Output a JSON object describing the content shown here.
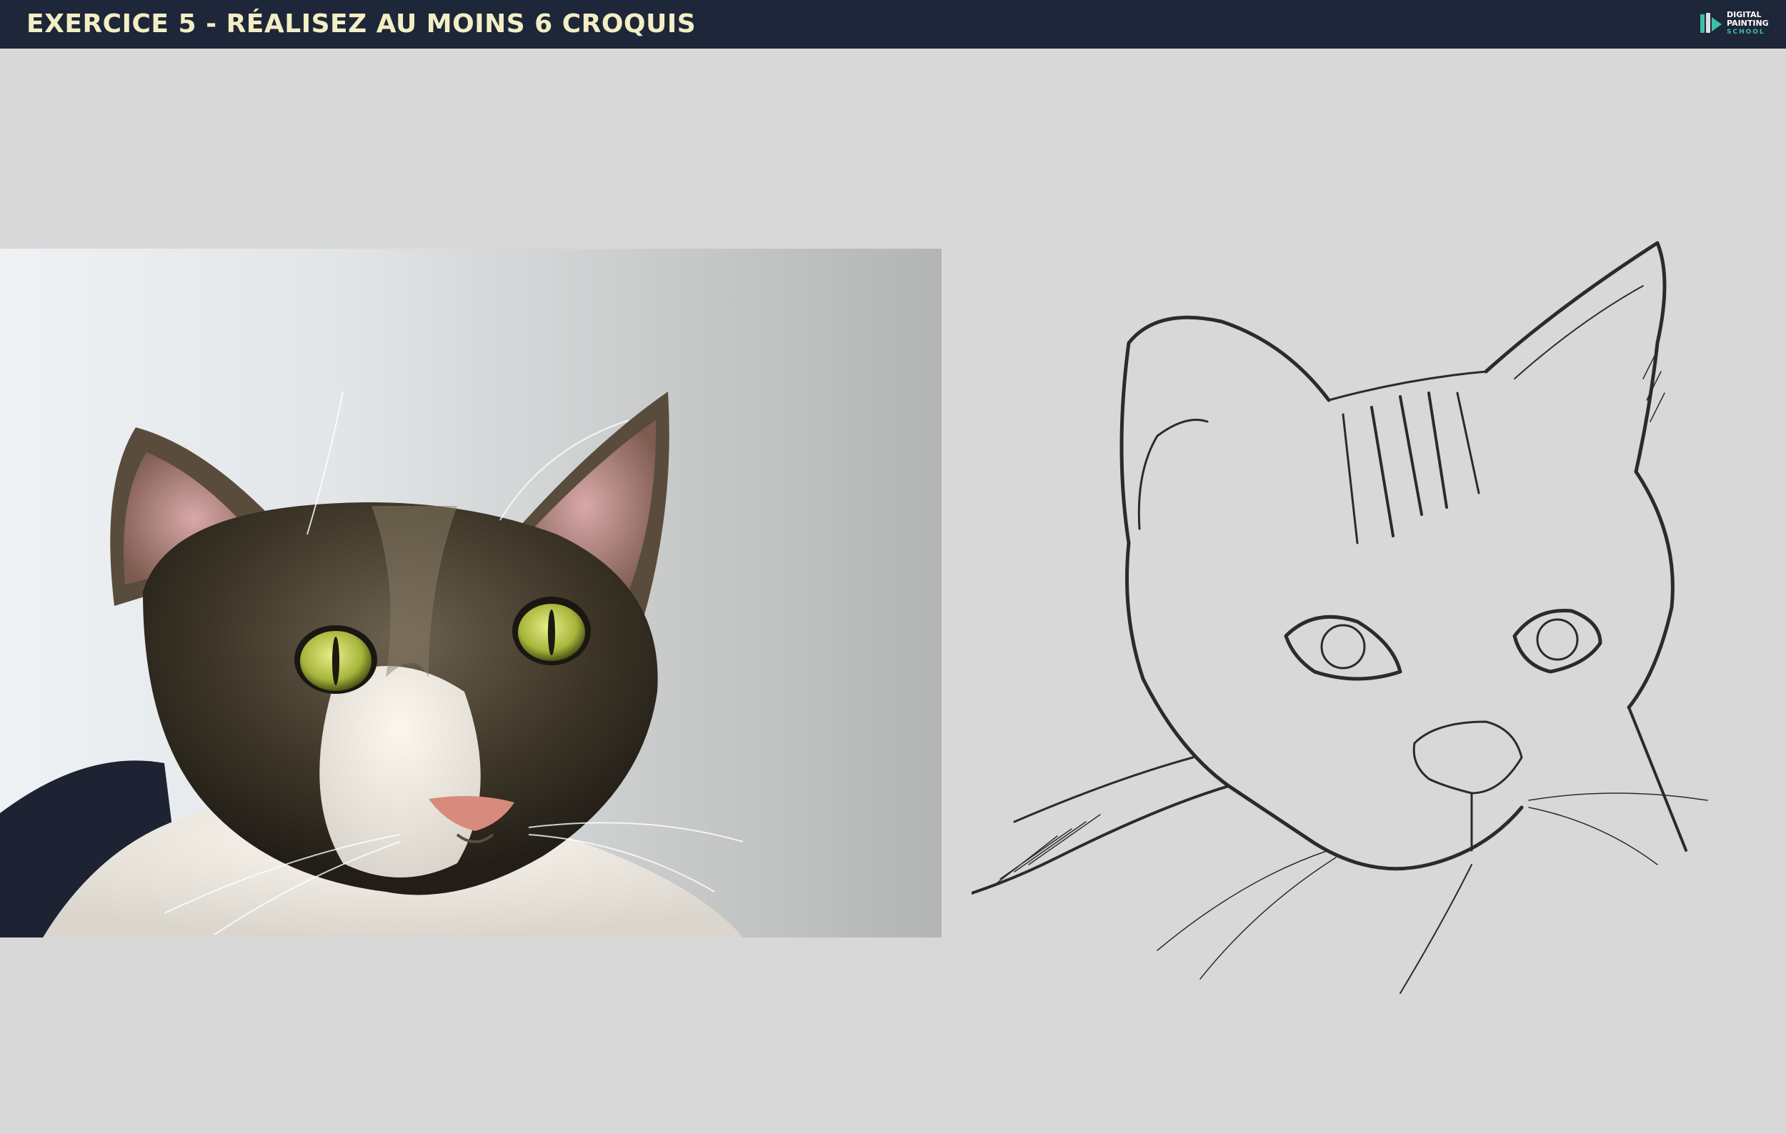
{
  "header": {
    "title": "EXERCICE 5 - RÉALISEZ AU MOINS 6 CROQUIS",
    "logo": {
      "line1": "DIGITAL",
      "line2": "PAINTING",
      "line3": "SCHOOL",
      "icon": "brush-pencil-icon"
    }
  },
  "colors": {
    "header_bg": "#1e2639",
    "title": "#f3efc4",
    "page_bg": "#d8d8d8",
    "logo_accent": "#3fbfa8"
  }
}
